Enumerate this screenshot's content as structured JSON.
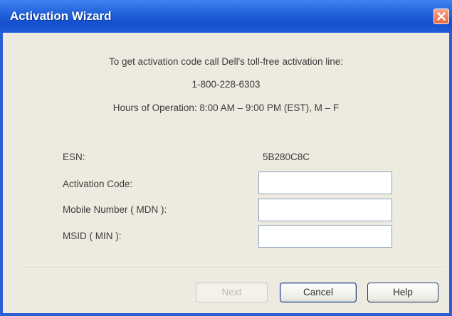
{
  "window": {
    "title": "Activation Wizard"
  },
  "info": {
    "line1": "To get activation code call Dell's toll-free activation line:",
    "phone": "1-800-228-6303",
    "hours": "Hours of Operation: 8:00 AM – 9:00 PM (EST), M – F"
  },
  "form": {
    "esn_label": "ESN:",
    "esn_value": "5B280C8C",
    "activation_code_label": "Activation Code:",
    "activation_code_value": "",
    "mdn_label": "Mobile Number ( MDN ):",
    "mdn_value": "",
    "msid_label": "MSID ( MIN ):",
    "msid_value": ""
  },
  "buttons": {
    "next": "Next",
    "cancel": "Cancel",
    "help": "Help"
  },
  "colors": {
    "titlebar": "#1f5fd9",
    "close": "#e4683f",
    "dialog_bg": "#edeadf"
  },
  "icons": {
    "close": "close-icon"
  }
}
